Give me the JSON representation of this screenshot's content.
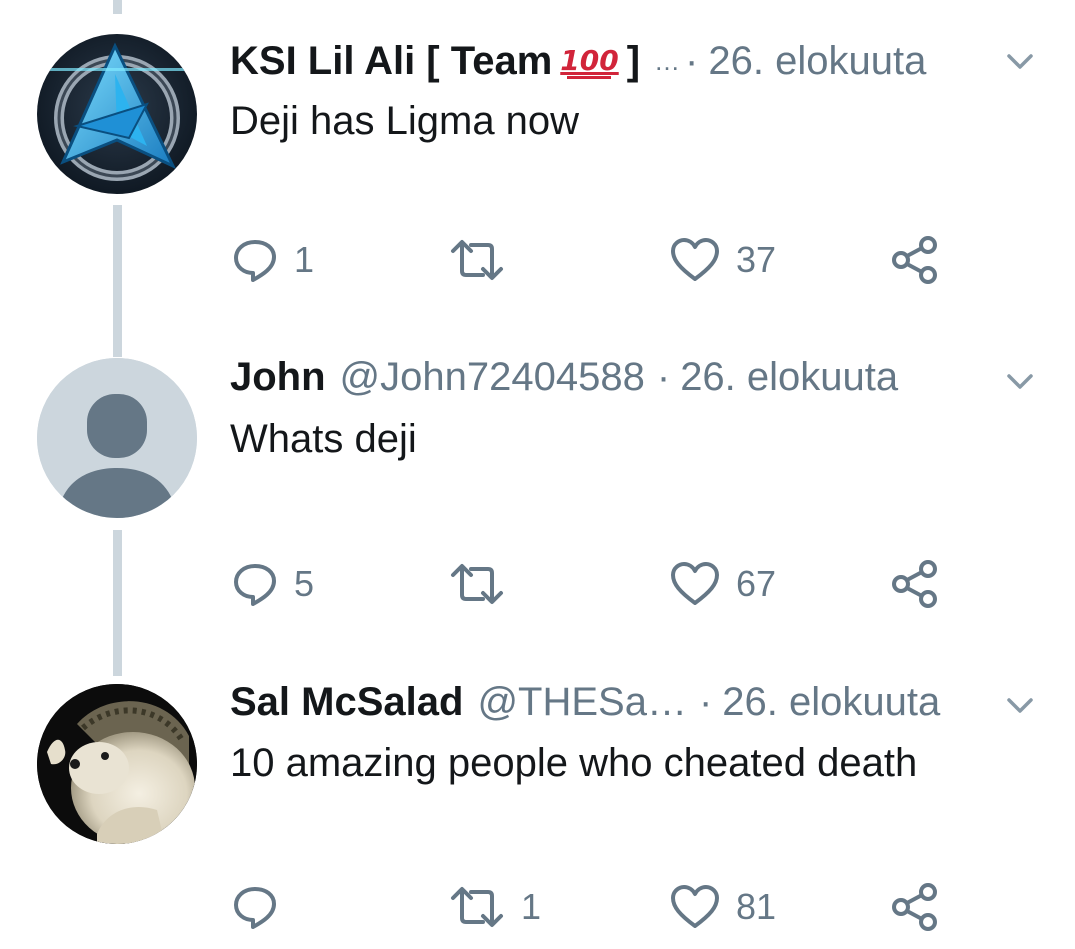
{
  "tweets": [
    {
      "name": "KSI Lil Ali [ Team",
      "name_emoji": "100",
      "name_suffix": "]",
      "ellipsis": "…",
      "dot": "·",
      "date": "26. elokuuta",
      "text": "Deji has Ligma now",
      "avatar": "ali-a-logo-avatar",
      "reply_count": "1",
      "retweet_count": "",
      "like_count": "37"
    },
    {
      "name": "John",
      "handle": "@John72404588",
      "dot": "·",
      "date": "26. elokuuta",
      "text": "Whats deji",
      "avatar": "default-profile-avatar",
      "reply_count": "5",
      "retweet_count": "",
      "like_count": "67"
    },
    {
      "name": "Sal McSalad",
      "handle": "@THESa…",
      "dot": "·",
      "date": "26. elokuuta",
      "text": "10 amazing people who cheated death",
      "avatar": "hedgehog-avatar",
      "reply_count": "",
      "retweet_count": "1",
      "like_count": "81"
    }
  ],
  "icons": {
    "reply": "reply-icon",
    "retweet": "retweet-icon",
    "like": "heart-icon",
    "share": "share-icon",
    "menu": "chevron-down-icon"
  },
  "colors": {
    "text_primary": "#14171a",
    "text_secondary": "#657786",
    "thread_line": "#ccd6dd",
    "emoji_red": "#d1243a"
  }
}
